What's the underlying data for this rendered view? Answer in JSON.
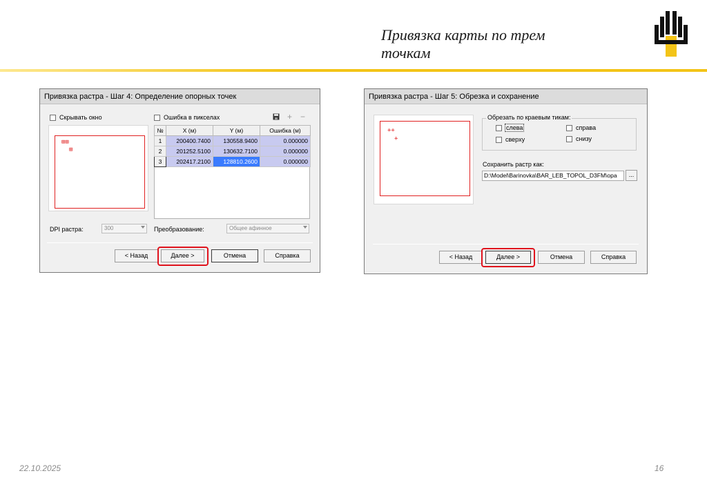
{
  "slide": {
    "title_line1": "Привязка карты по трем",
    "title_line2": "точкам",
    "date": "22.10.2025",
    "page": "16"
  },
  "colors": {
    "accent_gold": "#f3c418",
    "highlight_red": "#e0121c",
    "grid_selection": "#3a7bff"
  },
  "dialog4": {
    "title": "Привязка растра - Шаг 4: Определение опорных точек",
    "hide_window_label": "Скрывать окно",
    "error_pixels_label": "Ошибка в пикселах",
    "toolbar_icons": [
      "save-icon",
      "plus-icon",
      "minus-icon"
    ],
    "toolbar_plus": "+",
    "toolbar_minus": "−",
    "table": {
      "headers": [
        "№",
        "X (м)",
        "Y (м)",
        "Ошибка (м)"
      ],
      "rows": [
        [
          "1",
          "200400.7400",
          "130558.9400",
          "0.000000"
        ],
        [
          "2",
          "201252.5100",
          "130632.7100",
          "0.000000"
        ],
        [
          "3",
          "202417.2100",
          "128810.2600",
          "0.000000"
        ]
      ]
    },
    "markers": [
      "⊞⊞",
      "⊞"
    ],
    "dpi_label": "DPI растра:",
    "dpi_value": "300",
    "transform_label": "Преобразование:",
    "transform_value": "Общее афинное",
    "btn_back": "< Назад",
    "btn_next": "Далее >",
    "btn_cancel": "Отмена",
    "btn_help": "Справка"
  },
  "dialog5": {
    "title": "Привязка растра - Шаг 5: Обрезка и сохранение",
    "crop_group_label": "Обрезать по краевым тикам:",
    "crop_left": "слева",
    "crop_right": "справа",
    "crop_top": "сверху",
    "crop_bottom": "снизу",
    "markers": [
      "++",
      "+"
    ],
    "save_as_label": "Сохранить растр как:",
    "save_path": "D:\\Model\\Barinovka\\BAR_LEB_TOPOL_D3FM\\opa",
    "browse_label": "...",
    "btn_back": "< Назад",
    "btn_next": "Далее >",
    "btn_cancel": "Отмена",
    "btn_help": "Справка"
  }
}
